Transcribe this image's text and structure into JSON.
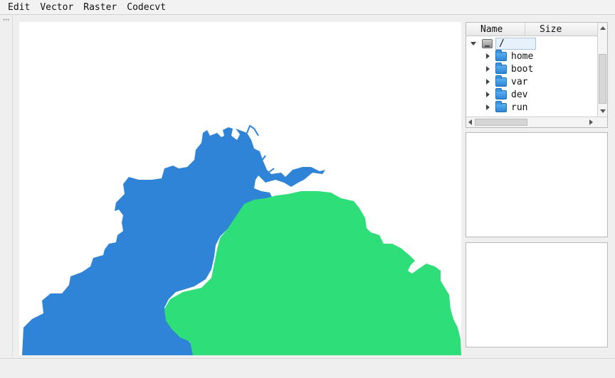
{
  "menubar": {
    "items": [
      "Edit",
      "Vector",
      "Raster",
      "Codecvt"
    ]
  },
  "map": {
    "colors": {
      "blue_region": "#2f84d8",
      "green_region": "#2ede78",
      "background": "#ffffff"
    }
  },
  "file_tree": {
    "columns": [
      "Name",
      "Size"
    ],
    "root": "/",
    "items": [
      "home",
      "boot",
      "var",
      "dev",
      "run"
    ]
  },
  "icons": [
    "drive-icon",
    "folder-icon",
    "expand-arrow-icon",
    "collapse-arrow-icon"
  ]
}
